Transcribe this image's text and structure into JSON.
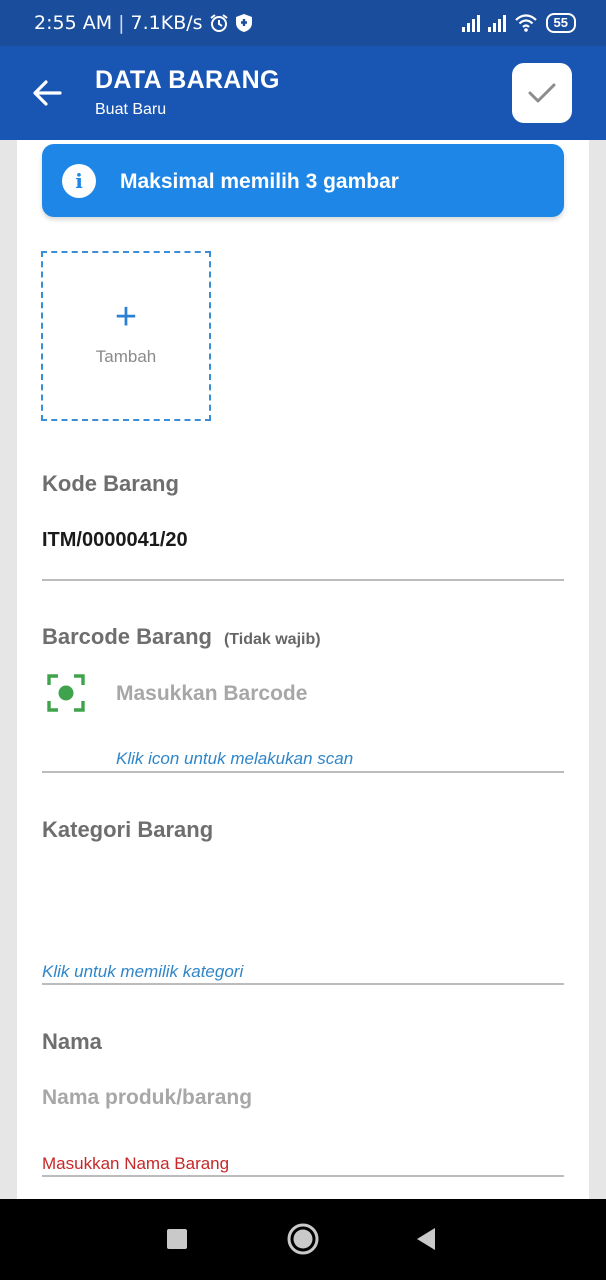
{
  "status_bar": {
    "time": "2:55 AM",
    "speed": "7.1KB/s",
    "battery": "55"
  },
  "app_bar": {
    "title": "DATA BARANG",
    "subtitle": "Buat Baru"
  },
  "info_banner": {
    "text": "Maksimal memilih 3 gambar"
  },
  "image_picker": {
    "add_label": "Tambah"
  },
  "fields": {
    "kode": {
      "label": "Kode Barang",
      "value": "ITM/0000041/20"
    },
    "barcode": {
      "label": "Barcode Barang",
      "note": "(Tidak wajib)",
      "placeholder": "Masukkan Barcode",
      "hint": "Klik icon untuk melakukan scan"
    },
    "kategori": {
      "label": "Kategori Barang",
      "hint": "Klik untuk memilik kategori"
    },
    "nama": {
      "label": "Nama",
      "placeholder": "Nama produk/barang",
      "error": "Masukkan Nama Barang"
    }
  },
  "colors": {
    "status_bar": "#1a4d9c",
    "app_bar": "#1956b4",
    "info": "#1e86e6",
    "scan_icon": "#3fa34d",
    "error": "#c62828",
    "hint": "#2f86c8"
  },
  "icons": {
    "back": "arrow-left-icon",
    "save": "check-icon",
    "info": "info-icon",
    "scan": "scan-icon"
  }
}
